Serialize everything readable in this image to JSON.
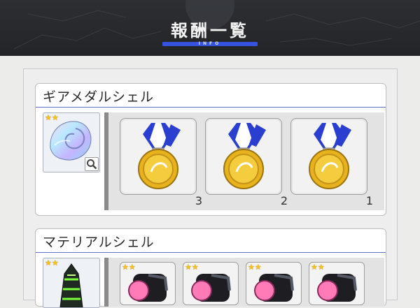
{
  "header": {
    "title": "報酬一覧",
    "subtitle": "INFO"
  },
  "sections": [
    {
      "title": "ギアメダルシェル",
      "item_icon": "nautilus-shell-icon",
      "rarity_icon": "two-stars-icon",
      "rewards": [
        {
          "icon": "gold-medal-icon",
          "count": "3"
        },
        {
          "icon": "gold-medal-icon",
          "count": "2"
        },
        {
          "icon": "gold-medal-icon",
          "count": "1"
        }
      ]
    },
    {
      "title": "マテリアルシェル",
      "item_icon": "spiral-shell-icon",
      "rarity_icon": "two-stars-icon",
      "rewards": [
        {
          "icon": "material-icon"
        },
        {
          "icon": "material-icon"
        },
        {
          "icon": "material-icon"
        },
        {
          "icon": "material-icon"
        }
      ]
    }
  ],
  "colors": {
    "accent": "#3652e0",
    "header_bg": "#2a2b2f",
    "star": "#f5c31e",
    "medal_gold": "#e8b21d",
    "ribbon_blue": "#2a3fd0"
  }
}
